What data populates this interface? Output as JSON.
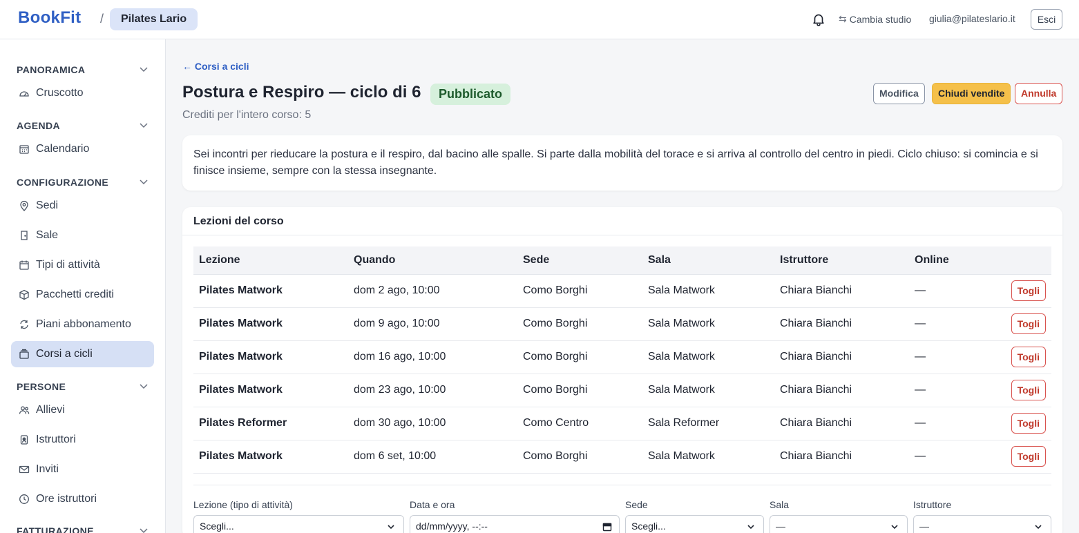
{
  "app": {
    "logo": "BookFit",
    "separator": "/",
    "studio": "Pilates Lario"
  },
  "header": {
    "switch_label": "Cambia studio",
    "user_email": "giulia@pilateslario.it",
    "logout_label": "Esci"
  },
  "sidebar": {
    "sections": [
      {
        "label": "PANORAMICA"
      },
      {
        "label": "AGENDA"
      },
      {
        "label": "CONFIGURAZIONE"
      },
      {
        "label": "PERSONE"
      },
      {
        "label": "FATTURAZIONE"
      }
    ],
    "items": [
      {
        "label": "Cruscotto",
        "icon": "gauge-icon"
      },
      {
        "label": "Calendario",
        "icon": "calendar-grid-icon"
      },
      {
        "label": "Sedi",
        "icon": "location-pin-icon"
      },
      {
        "label": "Sale",
        "icon": "door-icon"
      },
      {
        "label": "Tipi di attività",
        "icon": "calendar-icon"
      },
      {
        "label": "Pacchetti crediti",
        "icon": "box-icon"
      },
      {
        "label": "Piani abbonamento",
        "icon": "refresh-icon"
      },
      {
        "label": "Corsi a cicli",
        "icon": "layers-icon",
        "active": true
      },
      {
        "label": "Allievi",
        "icon": "users-icon"
      },
      {
        "label": "Istruttori",
        "icon": "badge-icon"
      },
      {
        "label": "Inviti",
        "icon": "mail-icon"
      },
      {
        "label": "Ore istruttori",
        "icon": "clock-icon"
      }
    ]
  },
  "page": {
    "back_label": "← Corsi a cicli",
    "title": "Postura e Respiro — ciclo di 6",
    "status": "Pubblicato",
    "subtitle": "Crediti per l'intero corso: 5",
    "actions": {
      "edit": "Modifica",
      "close_sales": "Chiudi vendite",
      "cancel": "Annulla"
    },
    "description": "Sei incontri per rieducare la postura e il respiro, dal bacino alle spalle. Si parte dalla mobilità del torace e si arriva al controllo del centro in piedi. Ciclo chiuso: si comincia e si finisce insieme, sempre con la stessa insegnante."
  },
  "lessons": {
    "title": "Lezioni del corso",
    "columns": [
      "Lezione",
      "Quando",
      "Sede",
      "Sala",
      "Istruttore",
      "Online"
    ],
    "remove_label": "Togli",
    "rows": [
      {
        "lesson": "Pilates Matwork",
        "when": "dom 2 ago, 10:00",
        "venue": "Como Borghi",
        "room": "Sala Matwork",
        "instructor": "Chiara Bianchi",
        "online": "—"
      },
      {
        "lesson": "Pilates Matwork",
        "when": "dom 9 ago, 10:00",
        "venue": "Como Borghi",
        "room": "Sala Matwork",
        "instructor": "Chiara Bianchi",
        "online": "—"
      },
      {
        "lesson": "Pilates Matwork",
        "when": "dom 16 ago, 10:00",
        "venue": "Como Borghi",
        "room": "Sala Matwork",
        "instructor": "Chiara Bianchi",
        "online": "—"
      },
      {
        "lesson": "Pilates Matwork",
        "when": "dom 23 ago, 10:00",
        "venue": "Como Borghi",
        "room": "Sala Matwork",
        "instructor": "Chiara Bianchi",
        "online": "—"
      },
      {
        "lesson": "Pilates Reformer",
        "when": "dom 30 ago, 10:00",
        "venue": "Como Centro",
        "room": "Sala Reformer",
        "instructor": "Chiara Bianchi",
        "online": "—"
      },
      {
        "lesson": "Pilates Matwork",
        "when": "dom 6 set, 10:00",
        "venue": "Como Borghi",
        "room": "Sala Matwork",
        "instructor": "Chiara Bianchi",
        "online": "—"
      }
    ]
  },
  "add_form": {
    "lesson_label": "Lezione (tipo di attività)",
    "lesson_value": "Scegli...",
    "datetime_label": "Data e ora",
    "datetime_placeholder": "dd/mm/yyyy, --:--",
    "venue_label": "Sede",
    "venue_value": "Scegli...",
    "room_label": "Sala",
    "room_value": "—",
    "instructor_label": "Istruttore",
    "instructor_value": "—"
  }
}
